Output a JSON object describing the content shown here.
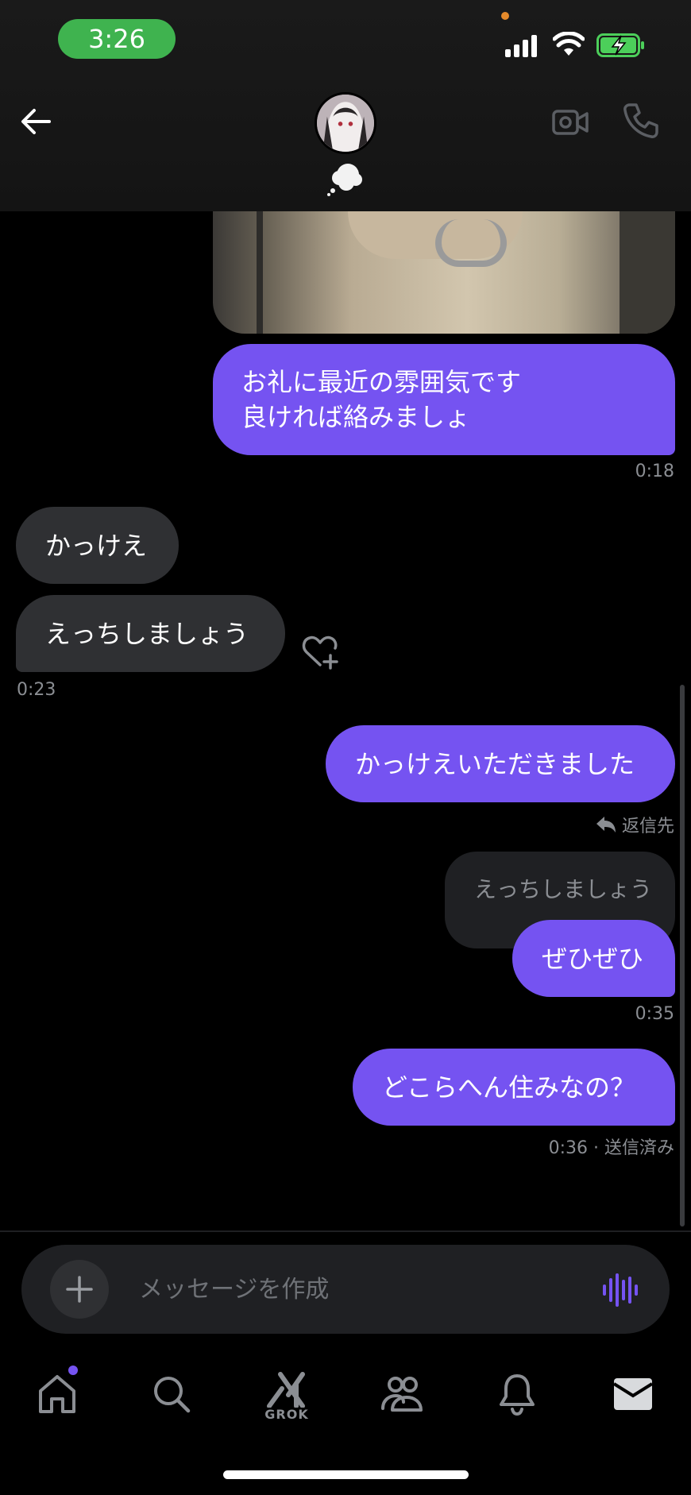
{
  "status_bar": {
    "time": "3:26"
  },
  "header": {
    "avatar_label": "avatar",
    "status_icon": "thought-bubble-icon"
  },
  "messages": [
    {
      "id": "m1",
      "type": "image",
      "direction": "out"
    },
    {
      "id": "m2",
      "direction": "out",
      "lines": [
        "お礼に最近の雰囲気です",
        "良ければ絡みましょ"
      ],
      "time": "0:18"
    },
    {
      "id": "m3",
      "direction": "in",
      "text": "かっけえ"
    },
    {
      "id": "m4",
      "direction": "in",
      "text": "えっちしましょう",
      "time": "0:23"
    },
    {
      "id": "m5",
      "direction": "out",
      "text": "かっけえいただきました"
    },
    {
      "id": "m6",
      "direction": "out",
      "reply_label": "返信先",
      "quoted": "えっちしましょう",
      "text": "ぜひぜひ",
      "time": "0:35"
    },
    {
      "id": "m7",
      "direction": "out",
      "text": "どこらへん住みなの？",
      "time": "0:36",
      "status": "· 送信済み"
    }
  ],
  "composer": {
    "placeholder": "メッセージを作成"
  },
  "nav": {
    "items": [
      "home-icon",
      "search-icon",
      "grok-icon",
      "communities-icon",
      "notifications-icon",
      "messages-icon"
    ],
    "grok_label": "GROK"
  },
  "colors": {
    "accent": "#7553f1",
    "incoming": "#2f3033",
    "background": "#000000"
  }
}
